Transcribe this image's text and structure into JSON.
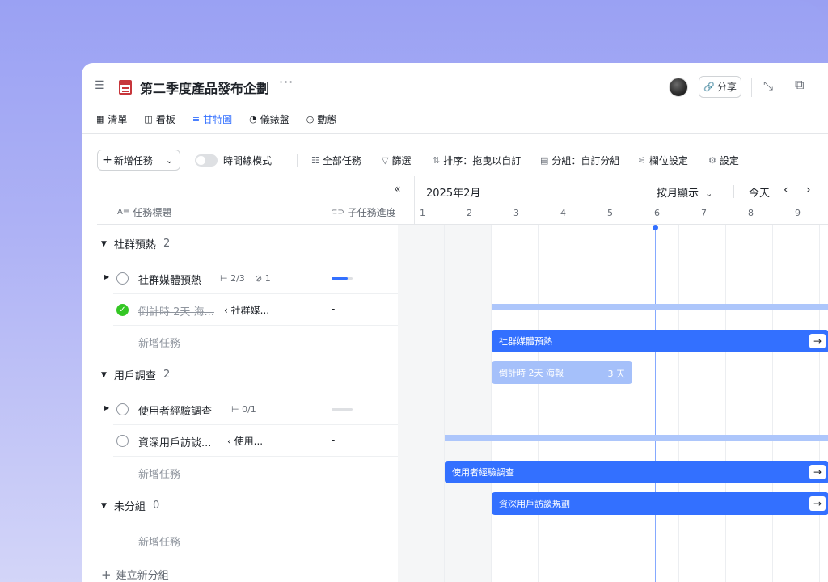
{
  "header": {
    "title": "第二季度產品發布企劃",
    "more": "···",
    "share_label": "分享"
  },
  "tabs": [
    {
      "label": "清單",
      "icon": "grid-icon"
    },
    {
      "label": "看板",
      "icon": "kanban-icon"
    },
    {
      "label": "甘特圖",
      "icon": "gantt-icon",
      "active": true
    },
    {
      "label": "儀錶盤",
      "icon": "dashboard-icon"
    },
    {
      "label": "動態",
      "icon": "history-icon"
    }
  ],
  "toolbar": {
    "new_task": "新增任務",
    "timeline_mode": "時間線模式",
    "all_tasks": "全部任務",
    "filter": "篩選",
    "sort": "排序：拖曳以自訂",
    "group": "分組：自訂分組",
    "field_settings": "欄位設定",
    "settings": "設定"
  },
  "list": {
    "col_title": "任務標題",
    "col_progress": "子任務進度",
    "groups": [
      {
        "name": "社群預熱",
        "count": "2"
      },
      {
        "name": "用戶調查",
        "count": "2"
      },
      {
        "name": "未分組",
        "count": "0"
      }
    ],
    "rows": [
      {
        "name": "社群媒體預熱",
        "subtasks": "2/3",
        "attachments": "1",
        "progress": 0.75
      },
      {
        "name": "倒計時 2天 海...",
        "parent": "社群媒...",
        "done": true,
        "progress_text": "-"
      },
      {
        "name": "使用者經驗調查",
        "subtasks": "0/1",
        "progress": 0
      },
      {
        "name": "資深用戶訪談...",
        "parent": "使用...",
        "progress_text": "-"
      }
    ],
    "add_task": "新增任務",
    "new_group": "建立新分組"
  },
  "gantt": {
    "month": "2025年2月",
    "view": "按月顯示",
    "today": "今天",
    "days": [
      "1",
      "2",
      "3",
      "4",
      "5",
      "6",
      "7",
      "8",
      "9"
    ],
    "bars": {
      "social": "社群媒體預熱",
      "countdown": "倒計時 2天 海報",
      "countdown_duration": "3 天",
      "ux": "使用者經驗調查",
      "interview": "資深用戶訪談規劃"
    }
  },
  "colors": {
    "accent": "#3370ff",
    "done": "#34c724",
    "bar_light": "#a5c0fa"
  }
}
